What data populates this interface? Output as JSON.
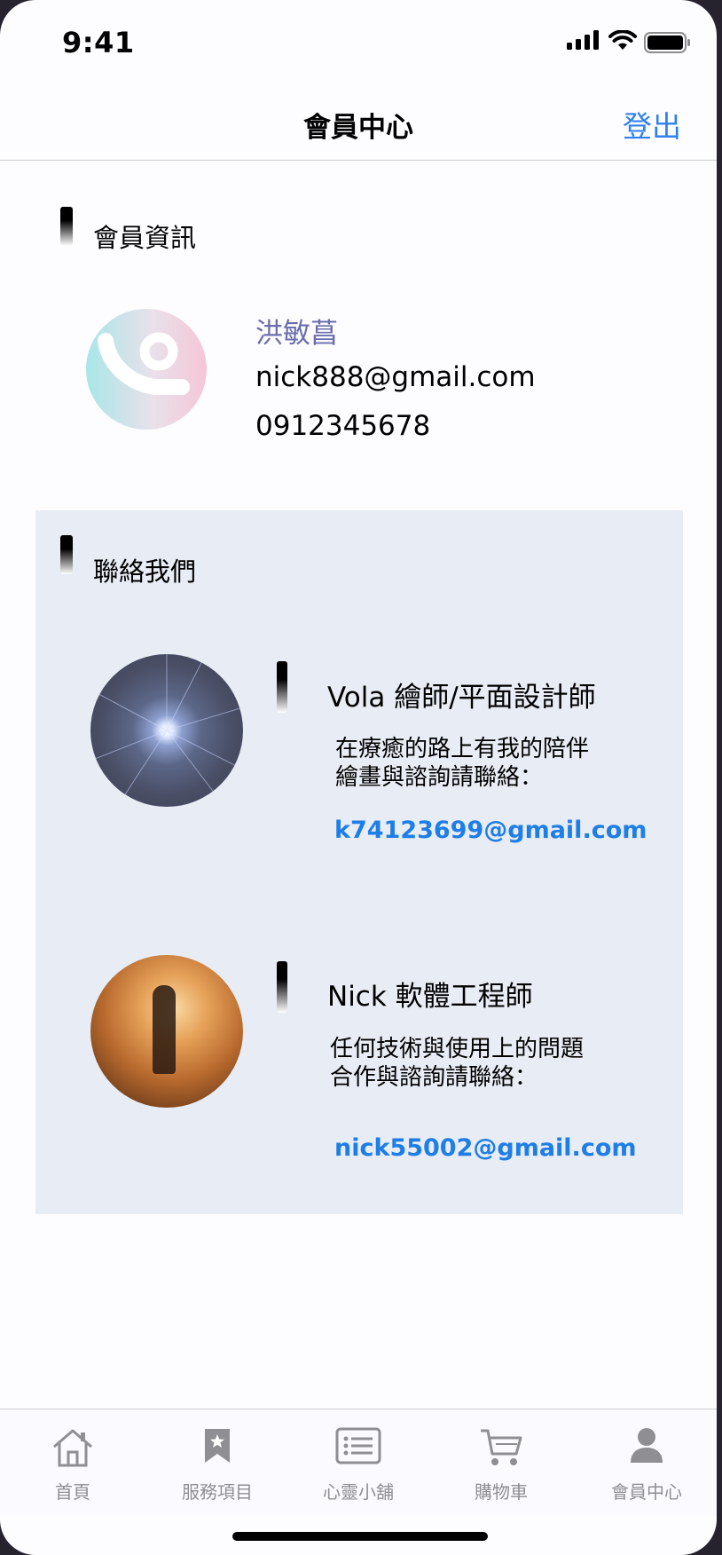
{
  "status_bar": {
    "time": "9:41"
  },
  "nav": {
    "title": "會員中心",
    "logout_label": "登出"
  },
  "member_section": {
    "title": "會員資訊",
    "name": "洪敏菖",
    "email": "nick888@gmail.com",
    "phone": "0912345678"
  },
  "contact_section": {
    "title": "聯絡我們",
    "contacts": [
      {
        "name": "Vola 繪師/平面設計師",
        "desc_line1": "在療癒的路上有我的陪伴",
        "desc_line2": "繪畫與諮詢請聯絡：",
        "email": "k74123699@gmail.com"
      },
      {
        "name": "Nick 軟體工程師",
        "desc_line1": "任何技術與使用上的問題",
        "desc_line2": "合作與諮詢請聯絡：",
        "email": "nick55002@gmail.com"
      }
    ]
  },
  "tab_bar": {
    "items": [
      {
        "label": "首頁",
        "icon": "home-icon"
      },
      {
        "label": "服務項目",
        "icon": "bookmark-star-icon"
      },
      {
        "label": "心靈小舖",
        "icon": "list-icon"
      },
      {
        "label": "購物車",
        "icon": "cart-icon"
      },
      {
        "label": "會員中心",
        "icon": "person-icon"
      }
    ],
    "active_index": 4
  },
  "colors": {
    "accent": "#2f80ed",
    "link": "#1e7ee8",
    "member_name": "#6b6ead",
    "panel_bg": "#e8ecf4",
    "tab_inactive": "#8e8e93",
    "tab_active": "#8e8e93"
  }
}
